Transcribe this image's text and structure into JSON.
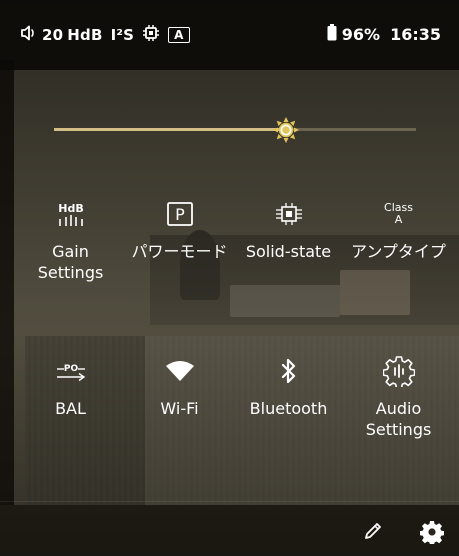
{
  "status_bar": {
    "volume_icon": "speaker-icon",
    "volume_value": "20",
    "volume_unit": "HdB",
    "i2s_label": "I²S",
    "chip_icon": "cpu-chip-icon",
    "mode_badge": "A",
    "battery_icon": "battery-icon",
    "battery_percent": "96%",
    "time": "16:35"
  },
  "brightness": {
    "icon": "sun-icon",
    "level": 0.64
  },
  "tiles_row1": [
    {
      "icon": "hdb-gain-icon",
      "label": "Gain Settings"
    },
    {
      "icon": "p-mode-icon",
      "label": "パワーモード"
    },
    {
      "icon": "solid-state-chip-icon",
      "label": "Solid-state"
    },
    {
      "icon": "class-a-icon",
      "icon_text_top": "Class",
      "icon_text_bottom": "A",
      "label": "アンプタイプ"
    }
  ],
  "tiles_row2": [
    {
      "icon": "po-output-icon",
      "icon_text": "PO",
      "label": "BAL"
    },
    {
      "icon": "wifi-icon",
      "label": "Wi-Fi"
    },
    {
      "icon": "bluetooth-icon",
      "label": "Bluetooth"
    },
    {
      "icon": "audio-settings-gear-icon",
      "label": "Audio Settings"
    }
  ],
  "bottom_bar": {
    "edit_icon": "pencil-icon",
    "settings_icon": "gear-icon"
  },
  "colors": {
    "accent": "#d3bf86",
    "thumb": "#e2c55a"
  }
}
